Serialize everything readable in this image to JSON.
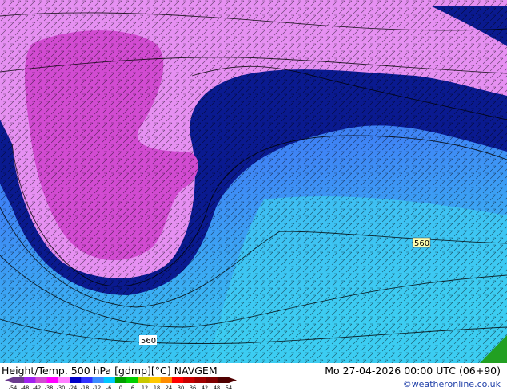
{
  "map": {
    "title": "Height/Temp. 500 hPa [gdmp][°C] NAVGEM",
    "datetime": "Mo 27-04-2026 00:00 UTC (06+90)",
    "credit": "©weatheronline.co.uk",
    "contour_labels": [
      "560",
      "560"
    ],
    "scale": {
      "ticks": [
        "-54",
        "-48",
        "-42",
        "-38",
        "-30",
        "-24",
        "-18",
        "-12",
        "-6",
        "0",
        "6",
        "12",
        "18",
        "24",
        "30",
        "36",
        "42",
        "48",
        "54"
      ],
      "colors": [
        "#6b3b8e",
        "#a020f0",
        "#d24bd2",
        "#ff00ff",
        "#ff80ff",
        "#0000c8",
        "#3232ff",
        "#3c8cff",
        "#00c8ff",
        "#00a000",
        "#00d000",
        "#c8c800",
        "#ffc800",
        "#ff8c00",
        "#ff0000",
        "#c80000",
        "#a00000",
        "#800000",
        "#500000"
      ]
    }
  }
}
